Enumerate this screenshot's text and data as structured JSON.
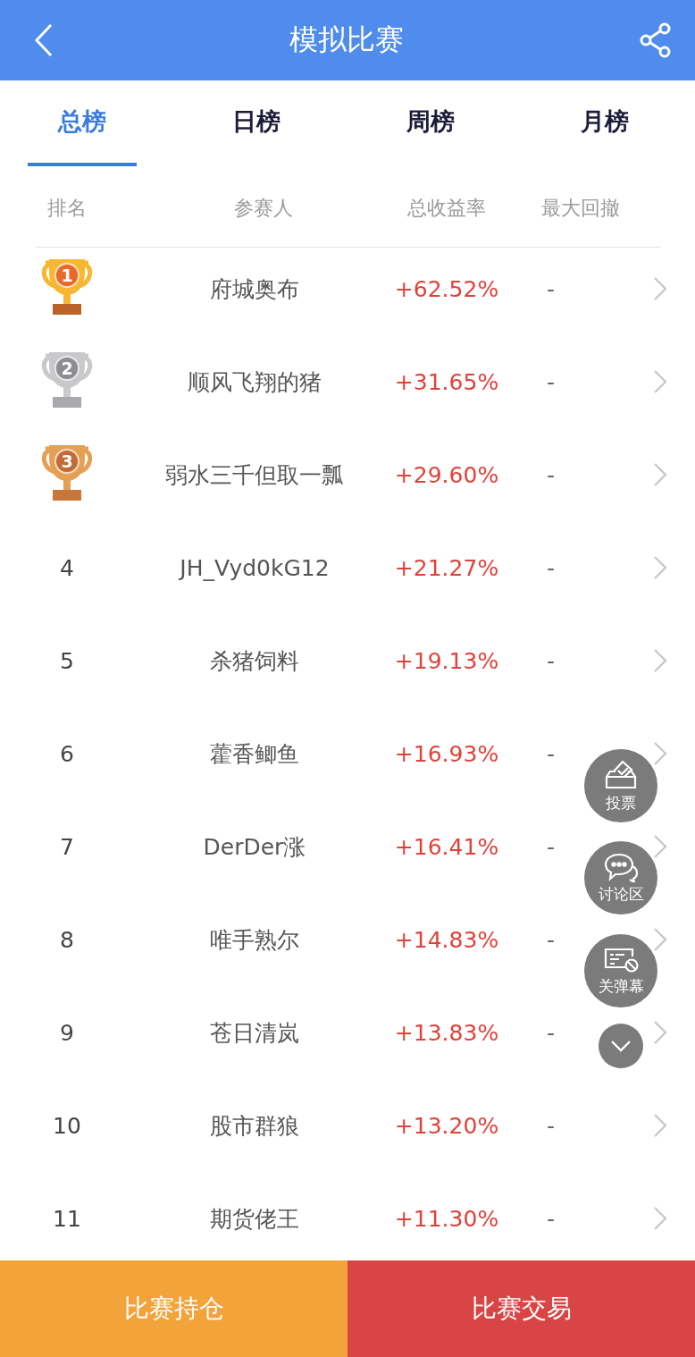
{
  "header": {
    "title": "模拟比赛"
  },
  "tabs": [
    {
      "label": "总榜",
      "selected": true
    },
    {
      "label": "日榜",
      "selected": false
    },
    {
      "label": "周榜",
      "selected": false
    },
    {
      "label": "月榜",
      "selected": false
    }
  ],
  "columns": [
    "排名",
    "参赛人",
    "总收益率",
    "最大回撤"
  ],
  "rows": [
    {
      "kind": "trophy",
      "color": "#f7b733",
      "rank": "1",
      "name": "府城奥布",
      "return": "+62.52%",
      "drawdown": "-"
    },
    {
      "kind": "trophy",
      "color": "#c9c9cc",
      "rank": "2",
      "name": "顺风飞翔的猪",
      "return": "+31.65%",
      "drawdown": "-"
    },
    {
      "kind": "trophy",
      "color": "#e4a055",
      "rank": "3",
      "name": "弱水三千但取一瓢",
      "return": "+29.60%",
      "drawdown": "-"
    },
    {
      "kind": "number",
      "rank": "4",
      "name": "JH_Vyd0kG12",
      "return": "+21.27%",
      "drawdown": "-"
    },
    {
      "kind": "number",
      "rank": "5",
      "name": "杀猪饲料",
      "return": "+19.13%",
      "drawdown": "-"
    },
    {
      "kind": "number",
      "rank": "6",
      "name": "藿香鲫鱼",
      "return": "+16.93%",
      "drawdown": "-"
    },
    {
      "kind": "number",
      "rank": "7",
      "name": "DerDer涨",
      "return": "+16.41%",
      "drawdown": "-"
    },
    {
      "kind": "number",
      "rank": "8",
      "name": "唯手熟尔",
      "return": "+14.83%",
      "drawdown": "-"
    },
    {
      "kind": "number",
      "rank": "9",
      "name": "苍日清岚",
      "return": "+13.83%",
      "drawdown": "-"
    },
    {
      "kind": "number",
      "rank": "10",
      "name": "股市群狼",
      "return": "+13.20%",
      "drawdown": "-"
    },
    {
      "kind": "number",
      "rank": "11",
      "name": "期货佬王",
      "return": "+11.30%",
      "drawdown": "-"
    }
  ],
  "floating_buttons": [
    {
      "kind": "vote",
      "label": "投票"
    },
    {
      "kind": "discuss",
      "label": "讨论区"
    },
    {
      "kind": "danmaku",
      "label": "关弹幕"
    },
    {
      "kind": "collapse"
    }
  ],
  "footer": {
    "left": "比赛持仓",
    "right": "比赛交易"
  }
}
